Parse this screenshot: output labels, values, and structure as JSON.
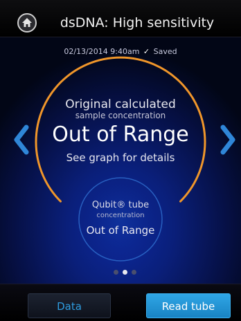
{
  "header": {
    "title": "dsDNA: High sensitivity",
    "home_icon": "home-icon"
  },
  "status": {
    "timestamp": "02/13/2014 9:40am",
    "saved_label": "Saved"
  },
  "main_result": {
    "line1": "Original calculated",
    "line2": "sample concentration",
    "value": "Out of Range",
    "hint": "See graph for details"
  },
  "tube_result": {
    "line1": "Qubit® tube",
    "line2": "concentration",
    "value": "Out of Range"
  },
  "pager": {
    "pages": 3,
    "active_index": 1
  },
  "footer": {
    "data_label": "Data",
    "read_label": "Read tube"
  },
  "colors": {
    "accent_orange": "#f0962a",
    "accent_blue": "#2fa6e6",
    "background_blue": "#0a1f7a"
  }
}
